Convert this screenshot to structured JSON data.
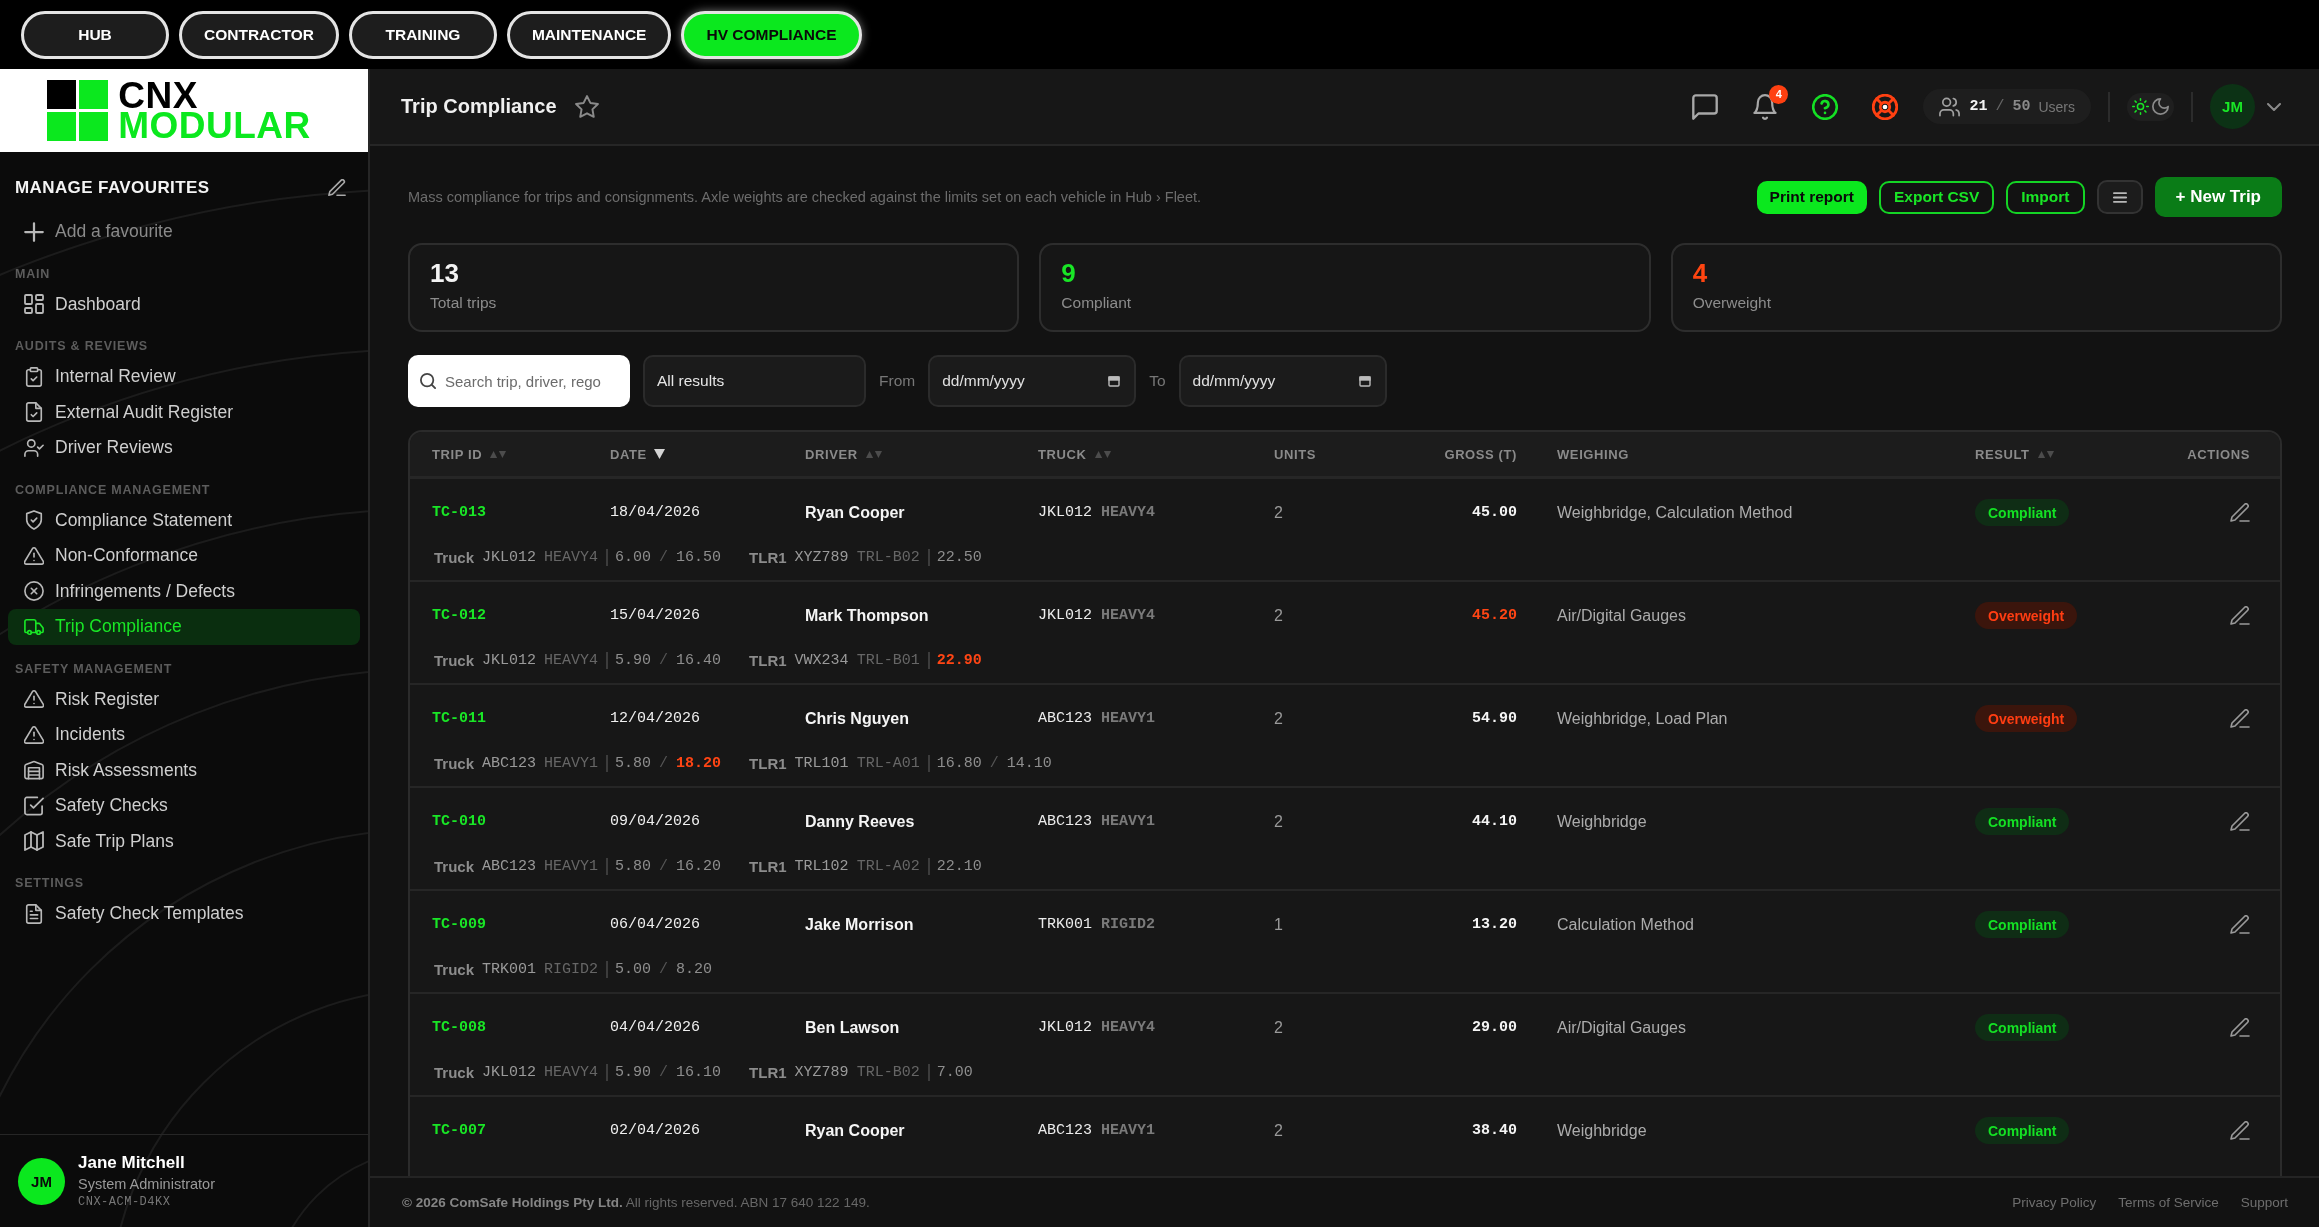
{
  "top_nav": {
    "items": [
      {
        "label": "HUB",
        "selected": false
      },
      {
        "label": "CONTRACTOR",
        "selected": false
      },
      {
        "label": "TRAINING",
        "selected": false
      },
      {
        "label": "MAINTENANCE",
        "selected": false
      },
      {
        "label": "HV COMPLIANCE",
        "selected": true
      }
    ]
  },
  "sidebar": {
    "logo": {
      "line_1": "CNX",
      "line_2": "MODULAR"
    },
    "favourites": {
      "title": "MANAGE FAVOURITES",
      "add_label": "Add a favourite"
    },
    "sections": [
      {
        "label": "MAIN",
        "items": [
          {
            "label": "Dashboard",
            "selected": false
          }
        ]
      },
      {
        "label": "AUDITS & REVIEWS",
        "items": [
          {
            "label": "Internal Review",
            "selected": false
          },
          {
            "label": "External Audit Register",
            "selected": false
          },
          {
            "label": "Driver Reviews",
            "selected": false
          }
        ]
      },
      {
        "label": "COMPLIANCE MANAGEMENT",
        "items": [
          {
            "label": "Compliance Statement",
            "selected": false
          },
          {
            "label": "Non-Conformance",
            "selected": false
          },
          {
            "label": "Infringements / Defects",
            "selected": false
          },
          {
            "label": "Trip Compliance",
            "selected": true
          }
        ]
      },
      {
        "label": "SAFETY MANAGEMENT",
        "items": [
          {
            "label": "Risk Register",
            "selected": false
          },
          {
            "label": "Incidents",
            "selected": false
          },
          {
            "label": "Risk Assessments",
            "selected": false
          },
          {
            "label": "Safety Checks",
            "selected": false
          },
          {
            "label": "Safe Trip Plans",
            "selected": false
          }
        ]
      },
      {
        "label": "SETTINGS",
        "items": [
          {
            "label": "Safety Check Templates",
            "selected": false
          }
        ]
      }
    ],
    "user": {
      "initials": "JM",
      "name": "Jane Mitchell",
      "role": "System Administrator",
      "code": "CNX-ACM-D4KX"
    }
  },
  "header": {
    "title": "Trip Compliance",
    "notification_count": "4",
    "users": {
      "count": "21",
      "separator": "/",
      "limit": "50",
      "label": "Users"
    },
    "theme_toggle": [
      {
        "selected": true
      },
      {
        "selected": false
      }
    ],
    "avatar_initials": "JM"
  },
  "toolbar": {
    "description": "Mass compliance for trips and consignments. Axle weights are checked against the limits set on each vehicle in Hub › Fleet.",
    "buttons": [
      {
        "kind": "primary",
        "label": "Print report"
      },
      {
        "kind": "outline",
        "label": "Export CSV"
      },
      {
        "kind": "outline",
        "label": "Import"
      },
      {
        "kind": "menu"
      },
      {
        "kind": "accent",
        "label": "+ New Trip"
      }
    ]
  },
  "stats": [
    {
      "value": "13",
      "label": "Total trips",
      "color": "#f2f2f2"
    },
    {
      "value": "9",
      "label": "Compliant",
      "color": "#19e626"
    },
    {
      "value": "4",
      "label": "Overweight",
      "color": "#ff4511"
    }
  ],
  "filters": {
    "search": {
      "placeholder": "Search trip, driver, rego"
    },
    "result": {
      "value": "All results"
    },
    "from": {
      "label": "From",
      "placeholder": "dd/mm/yyyy"
    },
    "to": {
      "label": "To",
      "placeholder": "dd/mm/yyyy"
    }
  },
  "table": {
    "columns": [
      {
        "label": "TRIP ID",
        "sortable": true,
        "sorted": false
      },
      {
        "label": "DATE",
        "sortable": true,
        "sorted": true
      },
      {
        "label": "DRIVER",
        "sortable": true,
        "sorted": false
      },
      {
        "label": "TRUCK",
        "sortable": true,
        "sorted": false
      },
      {
        "label": "UNITS"
      },
      {
        "label": "GROSS (T)"
      },
      {
        "label": "WEIGHING"
      },
      {
        "label": "RESULT",
        "sortable": true,
        "sorted": false
      },
      {
        "label": "ACTIONS"
      }
    ],
    "rows": [
      {
        "trip_id": "TC-013",
        "date": "18/04/2026",
        "driver": "Ryan Cooper",
        "truck": {
          "rego": "JKL012",
          "class": "HEAVY4"
        },
        "units": "2",
        "gross": "45.00",
        "gross_over": false,
        "weighing": "Weighbridge, Calculation Method",
        "result": {
          "label": "Compliant",
          "kind": "compliant"
        },
        "axle_units": [
          {
            "label": "Truck",
            "rego": "JKL012",
            "class": "HEAVY4",
            "weights": [
              {
                "value": "6.00",
                "over": false
              },
              {
                "separator": "/",
                "value": "16.50",
                "over": false
              }
            ]
          },
          {
            "label": "TLR1",
            "rego": "XYZ789",
            "class": "TRL-B02",
            "weights": [
              {
                "value": "22.50",
                "over": false
              }
            ]
          }
        ]
      },
      {
        "trip_id": "TC-012",
        "date": "15/04/2026",
        "driver": "Mark Thompson",
        "truck": {
          "rego": "JKL012",
          "class": "HEAVY4"
        },
        "units": "2",
        "gross": "45.20",
        "gross_over": true,
        "weighing": "Air/Digital Gauges",
        "result": {
          "label": "Overweight",
          "kind": "overweight"
        },
        "axle_units": [
          {
            "label": "Truck",
            "rego": "JKL012",
            "class": "HEAVY4",
            "weights": [
              {
                "value": "5.90",
                "over": false
              },
              {
                "separator": "/",
                "value": "16.40",
                "over": false
              }
            ]
          },
          {
            "label": "TLR1",
            "rego": "VWX234",
            "class": "TRL-B01",
            "weights": [
              {
                "value": "22.90",
                "over": true
              }
            ]
          }
        ]
      },
      {
        "trip_id": "TC-011",
        "date": "12/04/2026",
        "driver": "Chris Nguyen",
        "truck": {
          "rego": "ABC123",
          "class": "HEAVY1"
        },
        "units": "2",
        "gross": "54.90",
        "gross_over": false,
        "weighing": "Weighbridge, Load Plan",
        "result": {
          "label": "Overweight",
          "kind": "overweight"
        },
        "axle_units": [
          {
            "label": "Truck",
            "rego": "ABC123",
            "class": "HEAVY1",
            "weights": [
              {
                "value": "5.80",
                "over": false
              },
              {
                "separator": "/",
                "value": "18.20",
                "over": true
              }
            ]
          },
          {
            "label": "TLR1",
            "rego": "TRL101",
            "class": "TRL-A01",
            "weights": [
              {
                "value": "16.80",
                "over": false
              },
              {
                "separator": "/",
                "value": "14.10",
                "over": false
              }
            ]
          }
        ]
      },
      {
        "trip_id": "TC-010",
        "date": "09/04/2026",
        "driver": "Danny Reeves",
        "truck": {
          "rego": "ABC123",
          "class": "HEAVY1"
        },
        "units": "2",
        "gross": "44.10",
        "gross_over": false,
        "weighing": "Weighbridge",
        "result": {
          "label": "Compliant",
          "kind": "compliant"
        },
        "axle_units": [
          {
            "label": "Truck",
            "rego": "ABC123",
            "class": "HEAVY1",
            "weights": [
              {
                "value": "5.80",
                "over": false
              },
              {
                "separator": "/",
                "value": "16.20",
                "over": false
              }
            ]
          },
          {
            "label": "TLR1",
            "rego": "TRL102",
            "class": "TRL-A02",
            "weights": [
              {
                "value": "22.10",
                "over": false
              }
            ]
          }
        ]
      },
      {
        "trip_id": "TC-009",
        "date": "06/04/2026",
        "driver": "Jake Morrison",
        "truck": {
          "rego": "TRK001",
          "class": "RIGID2"
        },
        "units": "1",
        "gross": "13.20",
        "gross_over": false,
        "weighing": "Calculation Method",
        "result": {
          "label": "Compliant",
          "kind": "compliant"
        },
        "axle_units": [
          {
            "label": "Truck",
            "rego": "TRK001",
            "class": "RIGID2",
            "weights": [
              {
                "value": "5.00",
                "over": false
              },
              {
                "separator": "/",
                "value": "8.20",
                "over": false
              }
            ]
          }
        ]
      },
      {
        "trip_id": "TC-008",
        "date": "04/04/2026",
        "driver": "Ben Lawson",
        "truck": {
          "rego": "JKL012",
          "class": "HEAVY4"
        },
        "units": "2",
        "gross": "29.00",
        "gross_over": false,
        "weighing": "Air/Digital Gauges",
        "result": {
          "label": "Compliant",
          "kind": "compliant"
        },
        "axle_units": [
          {
            "label": "Truck",
            "rego": "JKL012",
            "class": "HEAVY4",
            "weights": [
              {
                "value": "5.90",
                "over": false
              },
              {
                "separator": "/",
                "value": "16.10",
                "over": false
              }
            ]
          },
          {
            "label": "TLR1",
            "rego": "XYZ789",
            "class": "TRL-B02",
            "weights": [
              {
                "value": "7.00",
                "over": false
              }
            ]
          }
        ]
      },
      {
        "trip_id": "TC-007",
        "date": "02/04/2026",
        "driver": "Ryan Cooper",
        "truck": {
          "rego": "ABC123",
          "class": "HEAVY1"
        },
        "units": "2",
        "gross": "38.40",
        "gross_over": false,
        "weighing": "Weighbridge",
        "result": {
          "label": "Compliant",
          "kind": "compliant"
        }
      }
    ]
  },
  "footer": {
    "copyright": "**© 2026 ComSafe Holdings Pty Ltd.** All rights reserved. ABN 17 640 122 149.",
    "links": [
      "Privacy Policy",
      "Terms of Service",
      "Support"
    ]
  }
}
